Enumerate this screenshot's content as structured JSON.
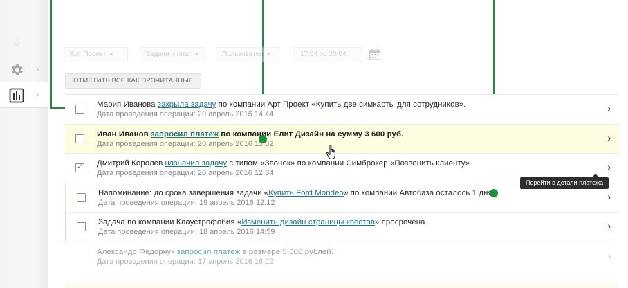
{
  "sidebar": {
    "items": [
      {
        "icon": "gear-icon",
        "active": false
      },
      {
        "icon": "bar-chart-icon",
        "active": true
      }
    ]
  },
  "filters": {
    "project": "Арт Проект",
    "type": "Задачи и плат",
    "user": "Пользовател",
    "date_range": "17.04 по 20.04"
  },
  "mark_all_label": "ОТМЕТИТЬ ВСЕ КАК ПРОЧИТАННЫЕ",
  "notifications": [
    {
      "parts": [
        "Мария Иванова ",
        "закрыла задачу",
        " по компании Арт Проект «Купить две симкарты для сотрудников»."
      ],
      "date": "Дата проведения операции: 20 апрель 2016 14:44",
      "checked": false
    },
    {
      "parts": [
        "Иван Иванов ",
        "запросил платеж",
        " по компании Елит Дизайн на сумму 3 600 руб."
      ],
      "date": "Дата проведения операции: 20 апрель 2016 15:02",
      "checked": false
    },
    {
      "parts": [
        "Дмитрий Королев ",
        "назначил задачу",
        " с типом «Звонок» по компании Симброкер «Позвонить клиенту»."
      ],
      "date": "Дата проведения операции: 20 апрель 2016 12:34",
      "checked": true
    },
    {
      "parts": [
        "Напоминание: до срока завершения задачи «",
        "Купить Ford Mondeo",
        "» по компании Автобаза осталось 1 дня."
      ],
      "date": "Дата проведения операции: 19 апрель 2016 12:12",
      "checked": false
    },
    {
      "parts": [
        "Задача по компании Клаустрофобия «",
        "Изменить дизайн страницы квестов",
        "» просрочена."
      ],
      "date": "Дата проведения операции: 18 апрель 2016 14:59",
      "checked": false
    },
    {
      "parts": [
        "Александр Федорчук ",
        "запросил платеж",
        " в размере 5 000 рублей."
      ],
      "date": "Дата проведения операции: 17 апрель 2016 16:22",
      "checked": false
    }
  ],
  "tooltip": "Перейти в детали платежа",
  "colors": {
    "guide": "#1d8f3a",
    "link": "#1b7688",
    "highlight_row": "#fdfde2"
  }
}
